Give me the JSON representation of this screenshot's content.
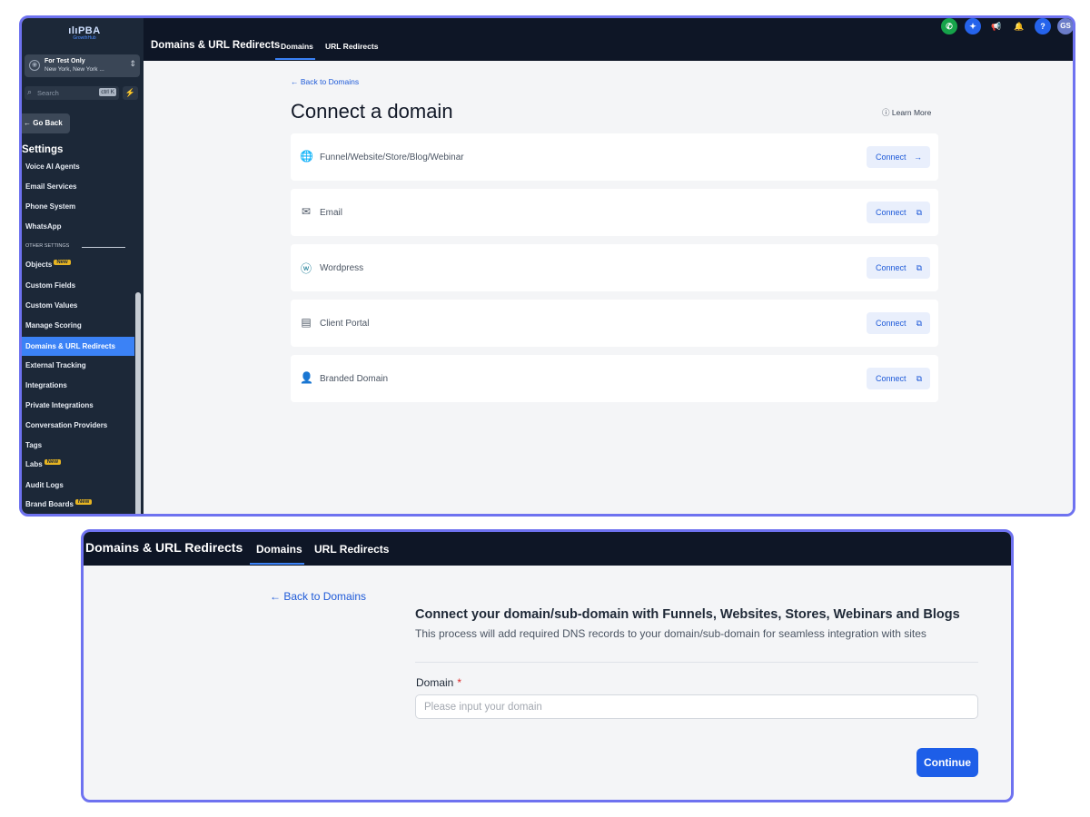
{
  "logo": {
    "name": "PBA",
    "tagline": "GrowthHub"
  },
  "account": {
    "name": "For Test Only",
    "location": "New York, New York ..."
  },
  "search": {
    "placeholder": "Search",
    "shortcut": "ctrl K"
  },
  "sidebar": {
    "go_back": "← Go Back",
    "settings_heading": "Settings",
    "other_settings_label": "OTHER SETTINGS",
    "new_badge": "New",
    "items_top": [
      "Voice AI Agents",
      "Email Services",
      "Phone System",
      "WhatsApp"
    ],
    "items": [
      {
        "label": "Objects",
        "new": true
      },
      {
        "label": "Custom Fields"
      },
      {
        "label": "Custom Values"
      },
      {
        "label": "Manage Scoring"
      },
      {
        "label": "Domains & URL Redirects",
        "active": true
      },
      {
        "label": "External Tracking"
      },
      {
        "label": "Integrations"
      },
      {
        "label": "Private Integrations"
      },
      {
        "label": "Conversation Providers"
      },
      {
        "label": "Tags"
      },
      {
        "label": "Labs",
        "new": true
      },
      {
        "label": "Audit Logs"
      },
      {
        "label": "Brand Boards",
        "new": true
      }
    ]
  },
  "header": {
    "title": "Domains & URL Redirects",
    "tabs": [
      "Domains",
      "URL Redirects"
    ],
    "avatar_initials": "GS",
    "help_label": "?"
  },
  "main": {
    "back_link": "← Back to Domains",
    "title": "Connect a domain",
    "learn_more": "Learn More",
    "connect_label": "Connect",
    "options": [
      {
        "label": "Funnel/Website/Store/Blog/Webinar",
        "icon": "globe-icon",
        "action_icon": "arrow-right-icon"
      },
      {
        "label": "Email",
        "icon": "envelope-icon",
        "action_icon": "external-link-icon"
      },
      {
        "label": "Wordpress",
        "icon": "wordpress-icon",
        "action_icon": "external-link-icon"
      },
      {
        "label": "Client Portal",
        "icon": "portal-icon",
        "action_icon": "external-link-icon"
      },
      {
        "label": "Branded Domain",
        "icon": "user-list-icon",
        "action_icon": "external-link-icon"
      }
    ]
  },
  "form": {
    "back_link": "Back to Domains",
    "heading": "Connect your domain/sub-domain with Funnels, Websites, Stores, Webinars and Blogs",
    "subheading": "This process will add required DNS records to your domain/sub-domain for seamless integration with sites",
    "field_label": "Domain",
    "required_mark": "*",
    "placeholder": "Please input your domain",
    "value": "",
    "submit_label": "Continue"
  },
  "colors": {
    "accent": "#1d5ee8",
    "sidebar_bg": "#1c2838",
    "topbar_bg": "#0e1626",
    "frame": "#6e72f0"
  }
}
